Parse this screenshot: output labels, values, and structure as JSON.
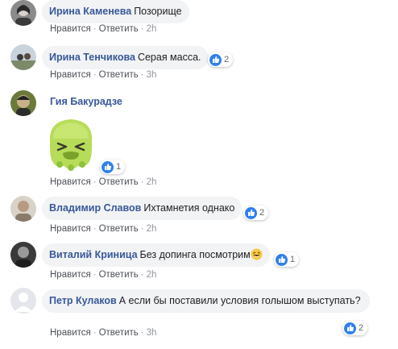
{
  "comments": [
    {
      "author": "Ирина Каменева",
      "text": "Позорище",
      "actions": {
        "like": "Нравится",
        "reply": "Ответить",
        "time": "2h"
      },
      "reaction_count": null
    },
    {
      "author": "Ирина Тенчикова",
      "text": "Серая масса.",
      "actions": {
        "like": "Нравится",
        "reply": "Ответить",
        "time": "3h"
      },
      "reaction_count": "2"
    },
    {
      "author": "Гия Бакурадзе",
      "text": "",
      "sticker": "sick-face-sticker",
      "actions": {
        "like": "Нравится",
        "reply": "Ответить",
        "time": "2h"
      },
      "reaction_count": "1"
    },
    {
      "author": "Владимир Славов",
      "text": "Ихтамнетия однако",
      "actions": {
        "like": "Нравится",
        "reply": "Ответить",
        "time": "2h"
      },
      "reaction_count": "2"
    },
    {
      "author": "Виталий Криница",
      "text": "Без допинга посмотрим",
      "emoji": "laughing-emoji",
      "actions": {
        "like": "Нравится",
        "reply": "Ответить",
        "time": "2h"
      },
      "reaction_count": "1"
    },
    {
      "author": "Петр Кулаков",
      "text": "А если бы поставили условия голышом выступать?",
      "actions": {
        "like": "Нравится",
        "reply": "Ответить",
        "time": "3h"
      },
      "reaction_count": "2"
    }
  ],
  "separator": "·",
  "colors": {
    "author": "#385898",
    "bubble": "#f2f3f5",
    "like_badge": "#2f80ed",
    "meta": "#90949c"
  }
}
